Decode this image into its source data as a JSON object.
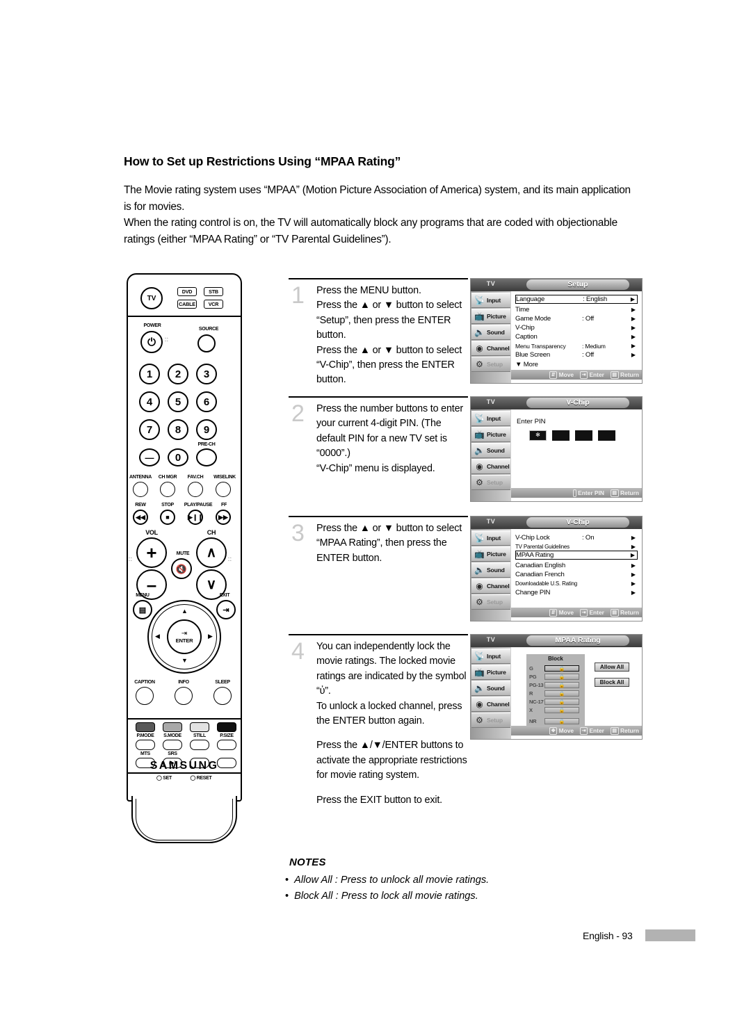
{
  "page": {
    "title": "How to Set up Restrictions Using “MPAA Rating”",
    "intro_line1": "The Movie rating system uses “MPAA” (Motion Picture Association of America) system, and its main application is for movies.",
    "intro_line2": "When the rating control is on, the TV will automatically block any programs that are coded with objectionable ratings (either “MPAA Rating” or “TV Parental Guidelines”).",
    "footer_text": "English - 93"
  },
  "steps": [
    {
      "number": "1",
      "lines": [
        "Press the MENU button.",
        "Press the ▲ or ▼ button to select “Setup”, then press the ENTER button.",
        "Press the ▲ or ▼ button to select “V-Chip”, then press the ENTER button."
      ]
    },
    {
      "number": "2",
      "lines": [
        "Press the number buttons to enter your current 4-digit PIN. (The default PIN for a new TV set is “0000”.)",
        "“V-Chip” menu is displayed."
      ]
    },
    {
      "number": "3",
      "lines": [
        "Press the ▲ or ▼ button to select “MPAA Rating”, then press the ENTER button."
      ]
    },
    {
      "number": "4",
      "lines": [
        "You can independently lock the movie ratings. The locked movie ratings are indicated by the symbol “ὐ”.",
        "To unlock a locked channel, press the ENTER button again.",
        "Press the ▲/▼/ENTER buttons to activate the appropriate restrictions for movie rating system.",
        "Press the EXIT button to exit."
      ]
    }
  ],
  "osd_common": {
    "tv_label": "TV",
    "sidebar": [
      "Input",
      "Picture",
      "Sound",
      "Channel",
      "Setup"
    ],
    "footer_move": "Move",
    "footer_enter": "Enter",
    "footer_return": "Return",
    "footer_enter_pin": "Enter PIN",
    "pin_digits_hint": "0~9"
  },
  "osd_setup": {
    "title": "Setup",
    "rows": [
      {
        "label": "Language",
        "value": ": English",
        "selected": true
      },
      {
        "label": "Time",
        "value": "",
        "selected": false
      },
      {
        "label": "Game Mode",
        "value": ": Off",
        "selected": false
      },
      {
        "label": "V-Chip",
        "value": "",
        "selected": false
      },
      {
        "label": "Caption",
        "value": "",
        "selected": false
      },
      {
        "label": "Menu Transparency",
        "value": ": Medium",
        "selected": false
      },
      {
        "label": "Blue Screen",
        "value": ": Off",
        "selected": false
      }
    ],
    "more": "▼ More"
  },
  "osd_pin": {
    "title": "V-Chip",
    "prompt": "Enter PIN",
    "boxes": [
      "✻",
      "",
      "",
      ""
    ]
  },
  "osd_vchip": {
    "title": "V-Chip",
    "rows": [
      {
        "label": "V-Chip Lock",
        "value": ": On",
        "selected": false,
        "small": false
      },
      {
        "label": "TV Parental Guidelines",
        "value": "",
        "selected": false,
        "small": true
      },
      {
        "label": "MPAA Rating",
        "value": "",
        "selected": true,
        "small": false
      },
      {
        "label": "Canadian English",
        "value": "",
        "selected": false,
        "small": false
      },
      {
        "label": "Canadian French",
        "value": "",
        "selected": false,
        "small": false
      },
      {
        "label": "Downloadable U.S. Rating",
        "value": "",
        "selected": false,
        "small": true
      },
      {
        "label": "Change PIN",
        "value": "",
        "selected": false,
        "small": false
      }
    ]
  },
  "osd_mpaa": {
    "title": "MPAA Rating",
    "column_header": "Block",
    "ratings": [
      "G",
      "PG",
      "PG-13",
      "R",
      "NC-17",
      "X",
      "NR"
    ],
    "lock_symbol": "ὐ",
    "allow_all": "Allow All",
    "block_all": "Block All"
  },
  "notes": {
    "heading": "NOTES",
    "items": [
      "Allow All : Press to unlock all movie ratings.",
      "Block All : Press to lock all movie ratings."
    ]
  },
  "remote": {
    "mode_tv": "TV",
    "mode_dvd": "DVD",
    "mode_stb": "STB",
    "mode_cable": "CABLE",
    "mode_vcr": "VCR",
    "power": "POWER",
    "source": "SOURCE",
    "numbers": [
      "1",
      "2",
      "3",
      "4",
      "5",
      "6",
      "7",
      "8",
      "9"
    ],
    "minus": "—",
    "zero": "0",
    "pre_ch": "PRE-CH",
    "row_antenna": "ANTENNA",
    "row_chmgr": "CH MGR",
    "row_favch": "FAV.CH",
    "row_wiselink": "WISELINK",
    "rew": "REW",
    "stop": "STOP",
    "play_pause": "PLAY/PAUSE",
    "ff": "FF",
    "vol": "VOL",
    "ch": "CH",
    "mute": "MUTE",
    "menu": "MENU",
    "exit": "EXIT",
    "enter": "ENTER",
    "caption": "CAPTION",
    "info": "INFO",
    "sleep": "SLEEP",
    "p_mode": "P.MODE",
    "s_mode": "S.MODE",
    "still": "STILL",
    "p_size": "P.SIZE",
    "mts": "MTS",
    "srs": "SRS",
    "set": "SET",
    "reset": "RESET",
    "brand": "SAMSUNG"
  }
}
